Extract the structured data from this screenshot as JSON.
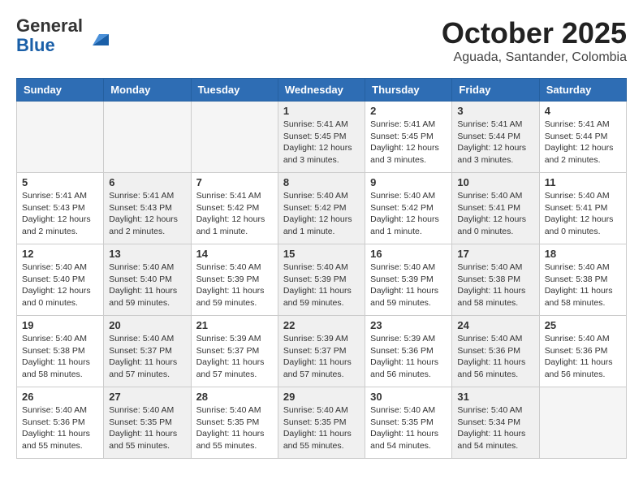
{
  "header": {
    "logo_general": "General",
    "logo_blue": "Blue",
    "month_title": "October 2025",
    "location": "Aguada, Santander, Colombia"
  },
  "weekdays": [
    "Sunday",
    "Monday",
    "Tuesday",
    "Wednesday",
    "Thursday",
    "Friday",
    "Saturday"
  ],
  "weeks": [
    [
      {
        "day": "",
        "info": "",
        "empty": true
      },
      {
        "day": "",
        "info": "",
        "empty": true
      },
      {
        "day": "",
        "info": "",
        "empty": true
      },
      {
        "day": "1",
        "info": "Sunrise: 5:41 AM\nSunset: 5:45 PM\nDaylight: 12 hours and 3 minutes."
      },
      {
        "day": "2",
        "info": "Sunrise: 5:41 AM\nSunset: 5:45 PM\nDaylight: 12 hours and 3 minutes."
      },
      {
        "day": "3",
        "info": "Sunrise: 5:41 AM\nSunset: 5:44 PM\nDaylight: 12 hours and 3 minutes."
      },
      {
        "day": "4",
        "info": "Sunrise: 5:41 AM\nSunset: 5:44 PM\nDaylight: 12 hours and 2 minutes."
      }
    ],
    [
      {
        "day": "5",
        "info": "Sunrise: 5:41 AM\nSunset: 5:43 PM\nDaylight: 12 hours and 2 minutes."
      },
      {
        "day": "6",
        "info": "Sunrise: 5:41 AM\nSunset: 5:43 PM\nDaylight: 12 hours and 2 minutes."
      },
      {
        "day": "7",
        "info": "Sunrise: 5:41 AM\nSunset: 5:42 PM\nDaylight: 12 hours and 1 minute."
      },
      {
        "day": "8",
        "info": "Sunrise: 5:40 AM\nSunset: 5:42 PM\nDaylight: 12 hours and 1 minute."
      },
      {
        "day": "9",
        "info": "Sunrise: 5:40 AM\nSunset: 5:42 PM\nDaylight: 12 hours and 1 minute."
      },
      {
        "day": "10",
        "info": "Sunrise: 5:40 AM\nSunset: 5:41 PM\nDaylight: 12 hours and 0 minutes."
      },
      {
        "day": "11",
        "info": "Sunrise: 5:40 AM\nSunset: 5:41 PM\nDaylight: 12 hours and 0 minutes."
      }
    ],
    [
      {
        "day": "12",
        "info": "Sunrise: 5:40 AM\nSunset: 5:40 PM\nDaylight: 12 hours and 0 minutes."
      },
      {
        "day": "13",
        "info": "Sunrise: 5:40 AM\nSunset: 5:40 PM\nDaylight: 11 hours and 59 minutes."
      },
      {
        "day": "14",
        "info": "Sunrise: 5:40 AM\nSunset: 5:39 PM\nDaylight: 11 hours and 59 minutes."
      },
      {
        "day": "15",
        "info": "Sunrise: 5:40 AM\nSunset: 5:39 PM\nDaylight: 11 hours and 59 minutes."
      },
      {
        "day": "16",
        "info": "Sunrise: 5:40 AM\nSunset: 5:39 PM\nDaylight: 11 hours and 59 minutes."
      },
      {
        "day": "17",
        "info": "Sunrise: 5:40 AM\nSunset: 5:38 PM\nDaylight: 11 hours and 58 minutes."
      },
      {
        "day": "18",
        "info": "Sunrise: 5:40 AM\nSunset: 5:38 PM\nDaylight: 11 hours and 58 minutes."
      }
    ],
    [
      {
        "day": "19",
        "info": "Sunrise: 5:40 AM\nSunset: 5:38 PM\nDaylight: 11 hours and 58 minutes."
      },
      {
        "day": "20",
        "info": "Sunrise: 5:40 AM\nSunset: 5:37 PM\nDaylight: 11 hours and 57 minutes."
      },
      {
        "day": "21",
        "info": "Sunrise: 5:39 AM\nSunset: 5:37 PM\nDaylight: 11 hours and 57 minutes."
      },
      {
        "day": "22",
        "info": "Sunrise: 5:39 AM\nSunset: 5:37 PM\nDaylight: 11 hours and 57 minutes."
      },
      {
        "day": "23",
        "info": "Sunrise: 5:39 AM\nSunset: 5:36 PM\nDaylight: 11 hours and 56 minutes."
      },
      {
        "day": "24",
        "info": "Sunrise: 5:40 AM\nSunset: 5:36 PM\nDaylight: 11 hours and 56 minutes."
      },
      {
        "day": "25",
        "info": "Sunrise: 5:40 AM\nSunset: 5:36 PM\nDaylight: 11 hours and 56 minutes."
      }
    ],
    [
      {
        "day": "26",
        "info": "Sunrise: 5:40 AM\nSunset: 5:36 PM\nDaylight: 11 hours and 55 minutes."
      },
      {
        "day": "27",
        "info": "Sunrise: 5:40 AM\nSunset: 5:35 PM\nDaylight: 11 hours and 55 minutes."
      },
      {
        "day": "28",
        "info": "Sunrise: 5:40 AM\nSunset: 5:35 PM\nDaylight: 11 hours and 55 minutes."
      },
      {
        "day": "29",
        "info": "Sunrise: 5:40 AM\nSunset: 5:35 PM\nDaylight: 11 hours and 55 minutes."
      },
      {
        "day": "30",
        "info": "Sunrise: 5:40 AM\nSunset: 5:35 PM\nDaylight: 11 hours and 54 minutes."
      },
      {
        "day": "31",
        "info": "Sunrise: 5:40 AM\nSunset: 5:34 PM\nDaylight: 11 hours and 54 minutes."
      },
      {
        "day": "",
        "info": "",
        "empty": true
      }
    ]
  ]
}
